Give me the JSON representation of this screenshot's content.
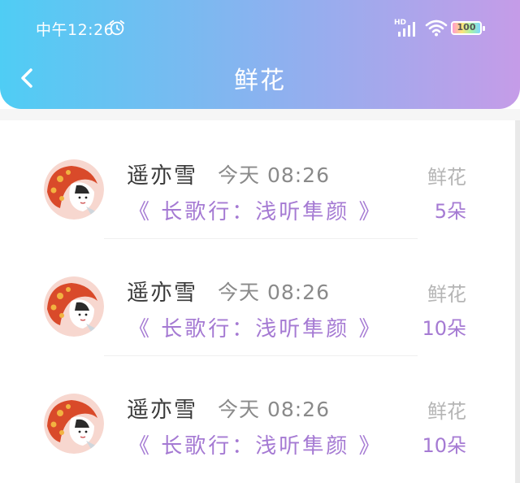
{
  "status_bar": {
    "time": "中午12:26",
    "network": "HD",
    "battery": "100"
  },
  "header": {
    "title": "鲜花"
  },
  "items": [
    {
      "name": "遥亦雪",
      "time": "今天 08:26",
      "poem": "《 长歌行：浅听隼颜 》",
      "gift_label": "鲜花",
      "gift_count": "5朵"
    },
    {
      "name": "遥亦雪",
      "time": "今天 08:26",
      "poem": "《 长歌行：浅听隼颜 》",
      "gift_label": "鲜花",
      "gift_count": "10朵"
    },
    {
      "name": "遥亦雪",
      "time": "今天 08:26",
      "poem": "《 长歌行：浅听隼颜 》",
      "gift_label": "鲜花",
      "gift_count": "10朵"
    }
  ],
  "colors": {
    "header_start": "#4fcdf4",
    "header_end": "#c59ce8",
    "accent_purple": "#a57ad3",
    "muted_gray": "#b5b5b5"
  }
}
